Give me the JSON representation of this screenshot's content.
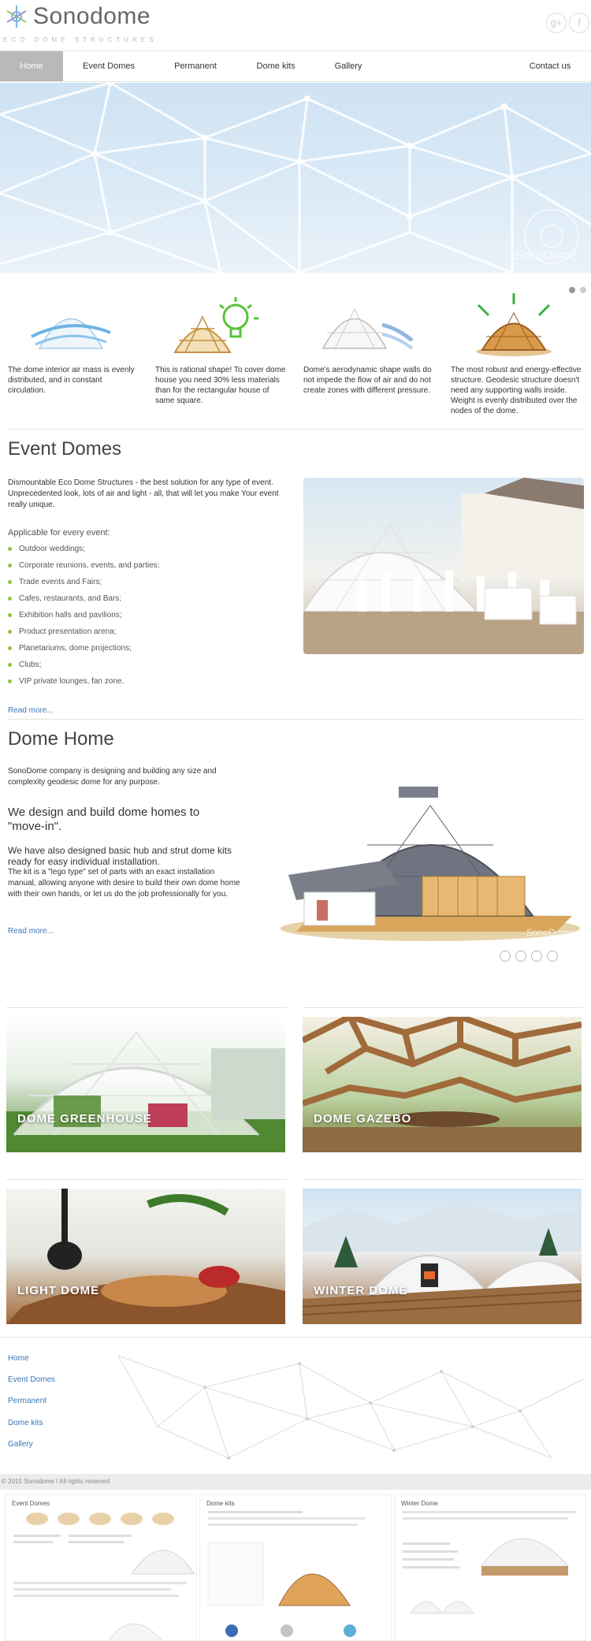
{
  "brand": {
    "name": "Sonodome",
    "tagline": "Eco Dome Structures"
  },
  "social": {
    "gplus": "g+",
    "facebook": "f"
  },
  "nav": [
    {
      "label": "Home",
      "active": true
    },
    {
      "label": "Event Domes",
      "active": false
    },
    {
      "label": "Permanent",
      "active": false
    },
    {
      "label": "Dome kits",
      "active": false
    },
    {
      "label": "Gallery",
      "active": false
    },
    {
      "label": "Contact us",
      "active": false
    }
  ],
  "hero": {
    "watermark": "SonoDome"
  },
  "features": [
    {
      "icon": "air-dome-icon",
      "text": "The dome interior air mass is evenly distributed, and in constant circulation."
    },
    {
      "icon": "lightbulb-dome-icon",
      "text": "This is rational shape! To cover dome house you need 30% less materials than for the rectangular house of same square."
    },
    {
      "icon": "wind-dome-icon",
      "text": "Dome's aerodynamic shape walls do not impede the flow of air and do not create zones with different pressure."
    },
    {
      "icon": "strong-dome-icon",
      "text": "The most robust and energy-effective structure. Geodesic structure doesn't need any supporting walls inside. Weight is evenly distributed over the nodes of the dome."
    }
  ],
  "event_domes": {
    "title": "Event Domes",
    "intro": "Dismountable Eco Dome Structures - the best solution for any type of event. Unprecedented look, lots of air and light - all, that will let you make Your event really unique.",
    "applicable_title": "Applicable for every event:",
    "items": [
      "Outdoor weddings;",
      "Corporate reunions, events, and parties;",
      "Trade events and Fairs;",
      "Cafes, restaurants, and Bars;",
      "Exhibition halls and pavilions;",
      "Product presentation arena;",
      "Planetariums, dome projections;",
      "Clubs;",
      "VIP private lounges, fan zone."
    ],
    "read_more": "Read more..."
  },
  "dome_home": {
    "title": "Dome Home",
    "intro": "SonoDome company is designing and building any size and complexity geodesic dome for any purpose.",
    "headline": "We design and build dome homes to \"move-in\".",
    "sub_headline": "We have also designed basic hub and strut dome kits ready for easy individual installation.",
    "body": "The kit is a \"lego type\" set of parts with an exact installation manual, allowing anyone with desire to build their own dome home with their own hands, or let us do the job professionally for you.",
    "read_more": "Read more...",
    "watermark": "SonoDome"
  },
  "tiles": [
    {
      "label": "Dome Greenhouse"
    },
    {
      "label": "Dome Gazebo"
    },
    {
      "label": "Light Dome"
    },
    {
      "label": "Winter Dome"
    }
  ],
  "footer": {
    "links": [
      "Home",
      "Event Domes",
      "Permanent",
      "Dome kits",
      "Gallery"
    ],
    "copyright": "© 2015 Sonodome / All rights reserved"
  },
  "thumbnails": [
    {
      "title": "Event Domes"
    },
    {
      "title": "Dome kits"
    },
    {
      "title": "Winter Dome"
    }
  ],
  "colors": {
    "nav_active": "#b9b9b9",
    "link": "#3a77b8",
    "bullet": "#8cc63f"
  }
}
